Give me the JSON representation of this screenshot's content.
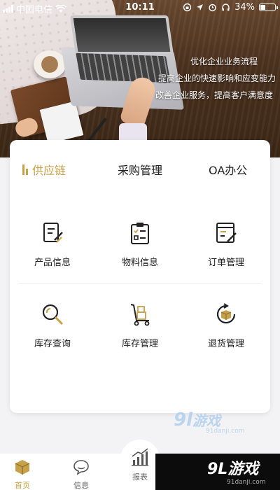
{
  "status_bar": {
    "carrier": "中国电信",
    "time": "10:11",
    "battery": "34%"
  },
  "hero": {
    "lines": [
      "优化企业业务流程",
      "提高企业的快速影响和应变能力",
      "改善企业服务，提高客户满意度"
    ]
  },
  "tabs": [
    {
      "label": "供应链",
      "active": true
    },
    {
      "label": "采购管理",
      "active": false
    },
    {
      "label": "OA办公",
      "active": false
    }
  ],
  "grid": [
    {
      "label": "产品信息",
      "icon": "document-edit-icon"
    },
    {
      "label": "物料信息",
      "icon": "clipboard-icon"
    },
    {
      "label": "订单管理",
      "icon": "order-edit-icon"
    },
    {
      "label": "库存查询",
      "icon": "magnifier-icon"
    },
    {
      "label": "库存管理",
      "icon": "hand-truck-icon"
    },
    {
      "label": "退货管理",
      "icon": "return-box-icon"
    }
  ],
  "watermark": {
    "big": "9",
    "rest": "游戏",
    "url": "91danji.com"
  },
  "nav": [
    {
      "label": "首页",
      "icon": "home-box-icon",
      "active": true
    },
    {
      "label": "信息",
      "icon": "chat-bubble-icon",
      "active": false
    },
    {
      "label": "报表",
      "icon": "chart-icon",
      "active": false
    }
  ],
  "brand": {
    "name": "9L游戏",
    "url": "91danji.com"
  },
  "colors": {
    "accent": "#c6a14a",
    "card": "#ffffff",
    "background": "#f3f3f5"
  }
}
